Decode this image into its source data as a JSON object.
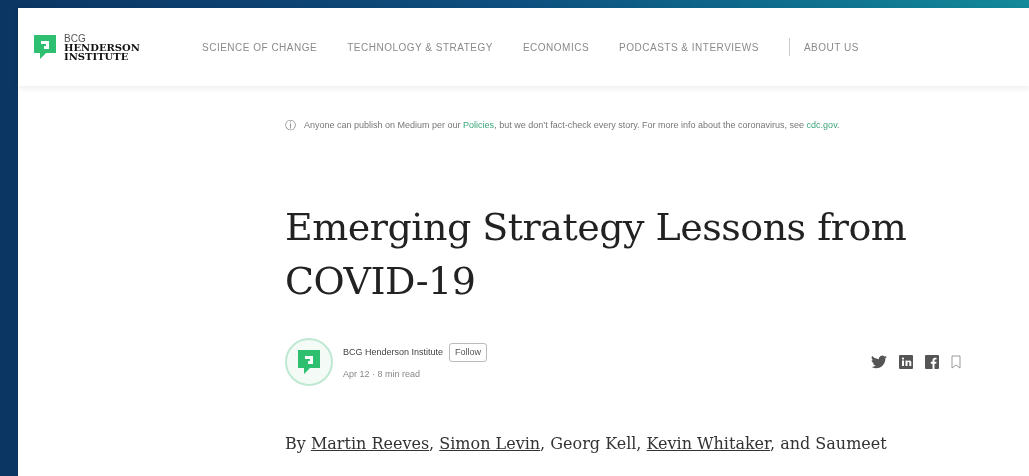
{
  "logo": {
    "lines": [
      "BCG",
      "HENDERSON",
      "INSTITUTE"
    ]
  },
  "nav": [
    {
      "label": "SCIENCE OF CHANGE",
      "kind": "link"
    },
    {
      "label": "TECHNOLOGY & STRATEGY",
      "kind": "link"
    },
    {
      "label": "ECONOMICS",
      "kind": "link"
    },
    {
      "label": "PODCASTS & INTERVIEWS",
      "kind": "link"
    },
    {
      "label": "ABOUT US",
      "kind": "divided"
    }
  ],
  "notice": {
    "icon": "ⓘ",
    "parts": [
      {
        "text": "Anyone can publish on Medium per our ",
        "link": false
      },
      {
        "text": "Policies",
        "link": true
      },
      {
        "text": ", but we don’t fact-check every story. For more info about the coronavirus, see ",
        "link": false
      },
      {
        "text": "cdc.gov",
        "link": true
      },
      {
        "text": ".",
        "link": false
      }
    ]
  },
  "title": "Emerging Strategy Lessons from COVID-19",
  "author": {
    "name": "BCG Henderson Institute",
    "follow": "Follow",
    "meta": "Apr 12 · 8 min read"
  },
  "byline": [
    {
      "text": "By ",
      "link": false
    },
    {
      "text": "Martin Reeves",
      "link": true
    },
    {
      "text": ", ",
      "link": false
    },
    {
      "text": "Simon Levin",
      "link": true
    },
    {
      "text": ", Georg Kell, ",
      "link": false
    },
    {
      "text": "Kevin Whitaker",
      "link": true
    },
    {
      "text": ", and Saumeet",
      "link": false
    }
  ]
}
